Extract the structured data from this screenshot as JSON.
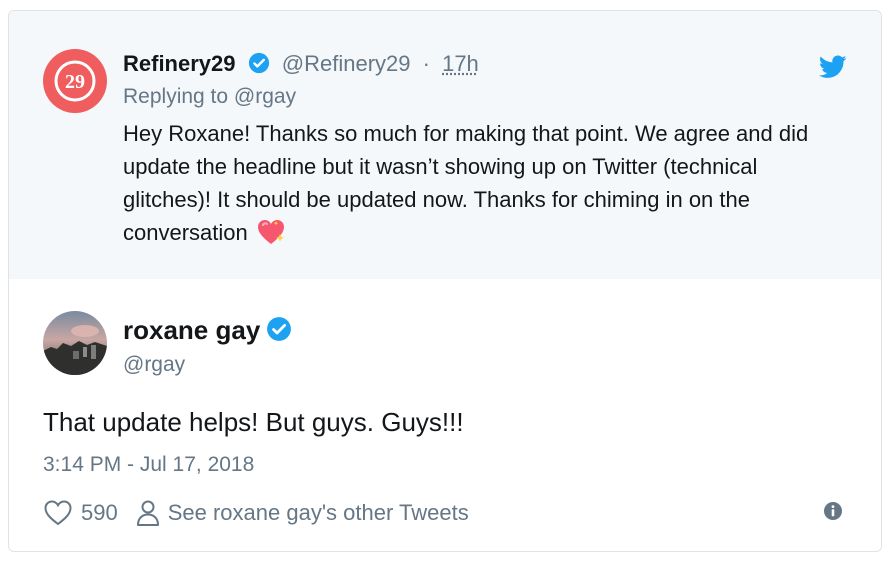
{
  "parent_tweet": {
    "name": "Refinery29",
    "handle": "@Refinery29",
    "separator": "·",
    "time": "17h",
    "replying_to": "Replying to @rgay",
    "text": "Hey Roxane! Thanks so much for making that point. We agree and did update the headline but it wasn’t showing up on Twitter (technical glitches)! It should be updated now. Thanks for chiming in on the conversation",
    "avatar_text": "29",
    "avatar_color": "#f05d5e"
  },
  "main_tweet": {
    "name": "roxane gay",
    "handle": "@rgay",
    "text": "That update helps! But guys. Guys!!!",
    "timestamp": "3:14 PM - Jul 17, 2018",
    "likes": "590",
    "other_tweets_link": "See roxane gay's other Tweets"
  },
  "colors": {
    "verified": "#1da1f2",
    "twitter_blue": "#1da1f2",
    "muted": "#657786",
    "parent_bg": "#f5f8fa"
  },
  "icons": [
    "verified-badge-icon",
    "twitter-bird-icon",
    "heart-icon",
    "person-icon",
    "info-icon",
    "sparkling-heart-emoji"
  ]
}
